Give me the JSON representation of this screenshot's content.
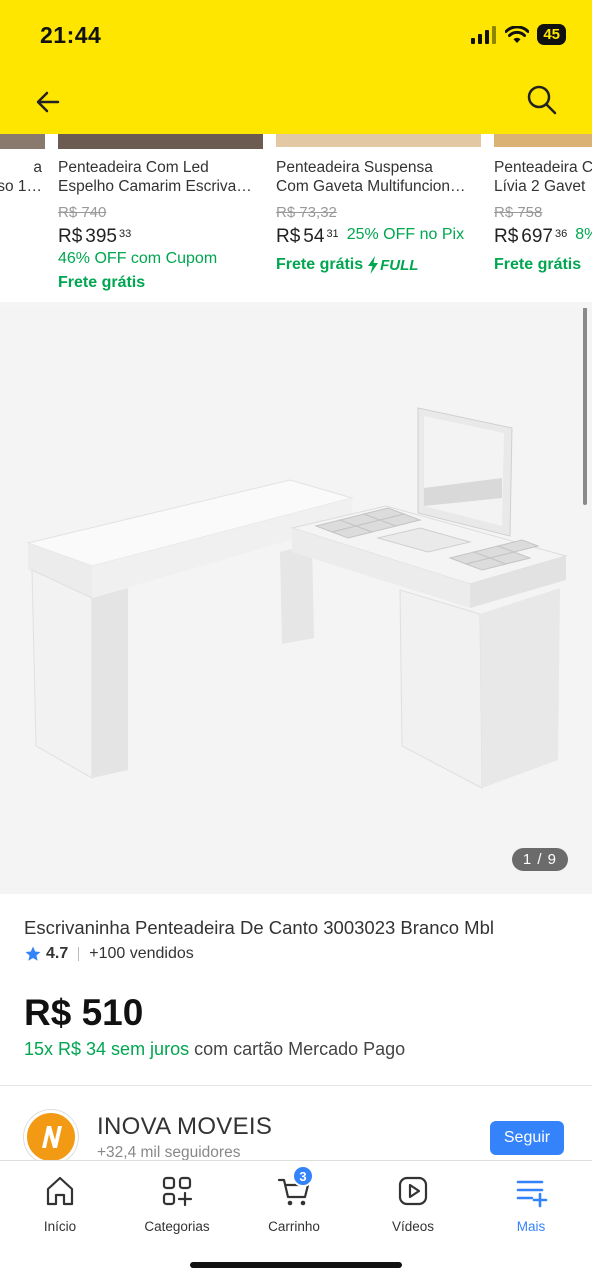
{
  "status_bar": {
    "time": "21:44",
    "battery": "45"
  },
  "carousel": [
    {
      "title_line1": "a",
      "title_line2": "so 1…",
      "old_price": "",
      "price_currency": "",
      "price_main": "",
      "price_cents": "",
      "promo": "",
      "freight": ""
    },
    {
      "title_line1": "Penteadeira Com Led",
      "title_line2": "Espelho Camarim Escriva…",
      "old_price": "R$ 740",
      "price_currency": "R$",
      "price_main": "395",
      "price_cents": "33",
      "promo": "46% OFF com Cupom",
      "freight": "Frete grátis"
    },
    {
      "title_line1": "Penteadeira Suspensa",
      "title_line2": "Com Gaveta Multifuncion…",
      "old_price": "R$ 73,32",
      "price_currency": "R$",
      "price_main": "54",
      "price_cents": "31",
      "discount": "25% OFF no Pix",
      "freight": "Frete grátis",
      "full_badge": "FULL"
    },
    {
      "title_line1": "Penteadeira C",
      "title_line2": "Lívia 2 Gavet",
      "old_price": "R$ 758",
      "price_currency": "R$",
      "price_main": "697",
      "price_cents": "36",
      "discount": "8%",
      "freight": "Frete grátis"
    }
  ],
  "image_counter": "1 / 9",
  "product": {
    "title": "Escrivaninha Penteadeira De Canto 3003023 Branco Mbl",
    "rating": "4.7",
    "sold": "+100 vendidos",
    "price": "R$ 510",
    "installments_green": "15x R$ 34 sem juros",
    "installments_rest": " com cartão Mercado Pago"
  },
  "seller": {
    "name": "INOVA MOVEIS",
    "followers": "+32,4 mil seguidores",
    "follow_label": "Seguir"
  },
  "tabs": [
    {
      "label": "Início",
      "icon": "home-icon"
    },
    {
      "label": "Categorias",
      "icon": "categories-icon"
    },
    {
      "label": "Carrinho",
      "icon": "cart-icon",
      "badge": "3"
    },
    {
      "label": "Vídeos",
      "icon": "video-icon"
    },
    {
      "label": "Mais",
      "icon": "more-icon",
      "active": true
    }
  ],
  "colors": {
    "header_yellow": "#ffe600",
    "accent_blue": "#3483fa",
    "green": "#00a650"
  }
}
